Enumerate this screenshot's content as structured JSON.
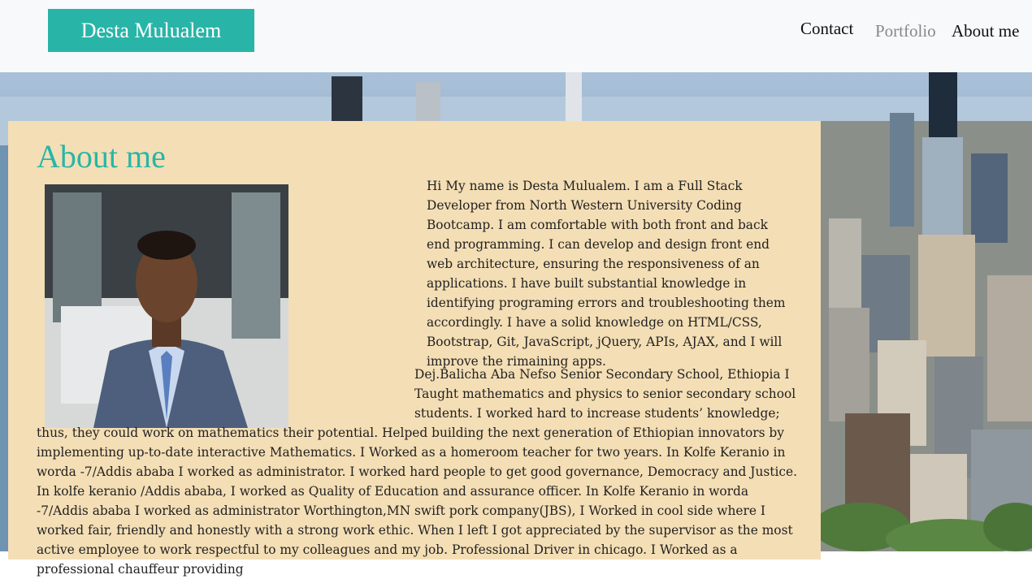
{
  "navbar": {
    "brand": "Desta Mulualem",
    "links": [
      "Contact",
      "Portfolio",
      "About me"
    ]
  },
  "main": {
    "title": "About me",
    "photo_alt": "portrait photo",
    "paragraph1": "Hi My name is Desta Mulualem. I am a Full Stack Developer from North Western University Coding Bootcamp. I am comfortable with both front and back end programming. I can develop and design front end web architecture, ensuring the responsiveness of an applications. I have built substantial knowledge in identifying programing errors and troubleshooting them accordingly. I have a solid knowledge on HTML/CSS, Bootstrap, Git, JavaScript, jQuery, APIs, AJAX, and I will improve the rimaining apps.",
    "paragraph2": "Dej.Balicha Aba Nefso Senior Secondary School, Ethiopia I Taught mathematics and physics to senior secondary school students. I worked hard to increase students’ knowledge; thus, they could work on mathematics their potential. Helped building the next generation of Ethiopian innovators by implementing up-to-date interactive Mathematics. I Worked as a homeroom teacher for two years. In Kolfe Keranio in worda -7/Addis ababa I worked as administrator. I worked hard people to get good governance, Democracy and Justice. In kolfe keranio /Addis ababa, I worked as Quality of Education and assurance officer. In Kolfe Keranio in worda -7/Addis ababa I worked as administrator Worthington,MN swift pork company(JBS), I Worked in cool side where I worked fair, friendly and honestly with a strong work ethic. When I left I got appreciated by the supervisor as the most active employee to work respectful to my colleagues and my job. Professional Driver in chicago. I Worked as a professional chauffeur providing"
  },
  "colors": {
    "accent": "#28b5a8",
    "card": "#f4deb5",
    "navbar": "#f8f9fa"
  }
}
